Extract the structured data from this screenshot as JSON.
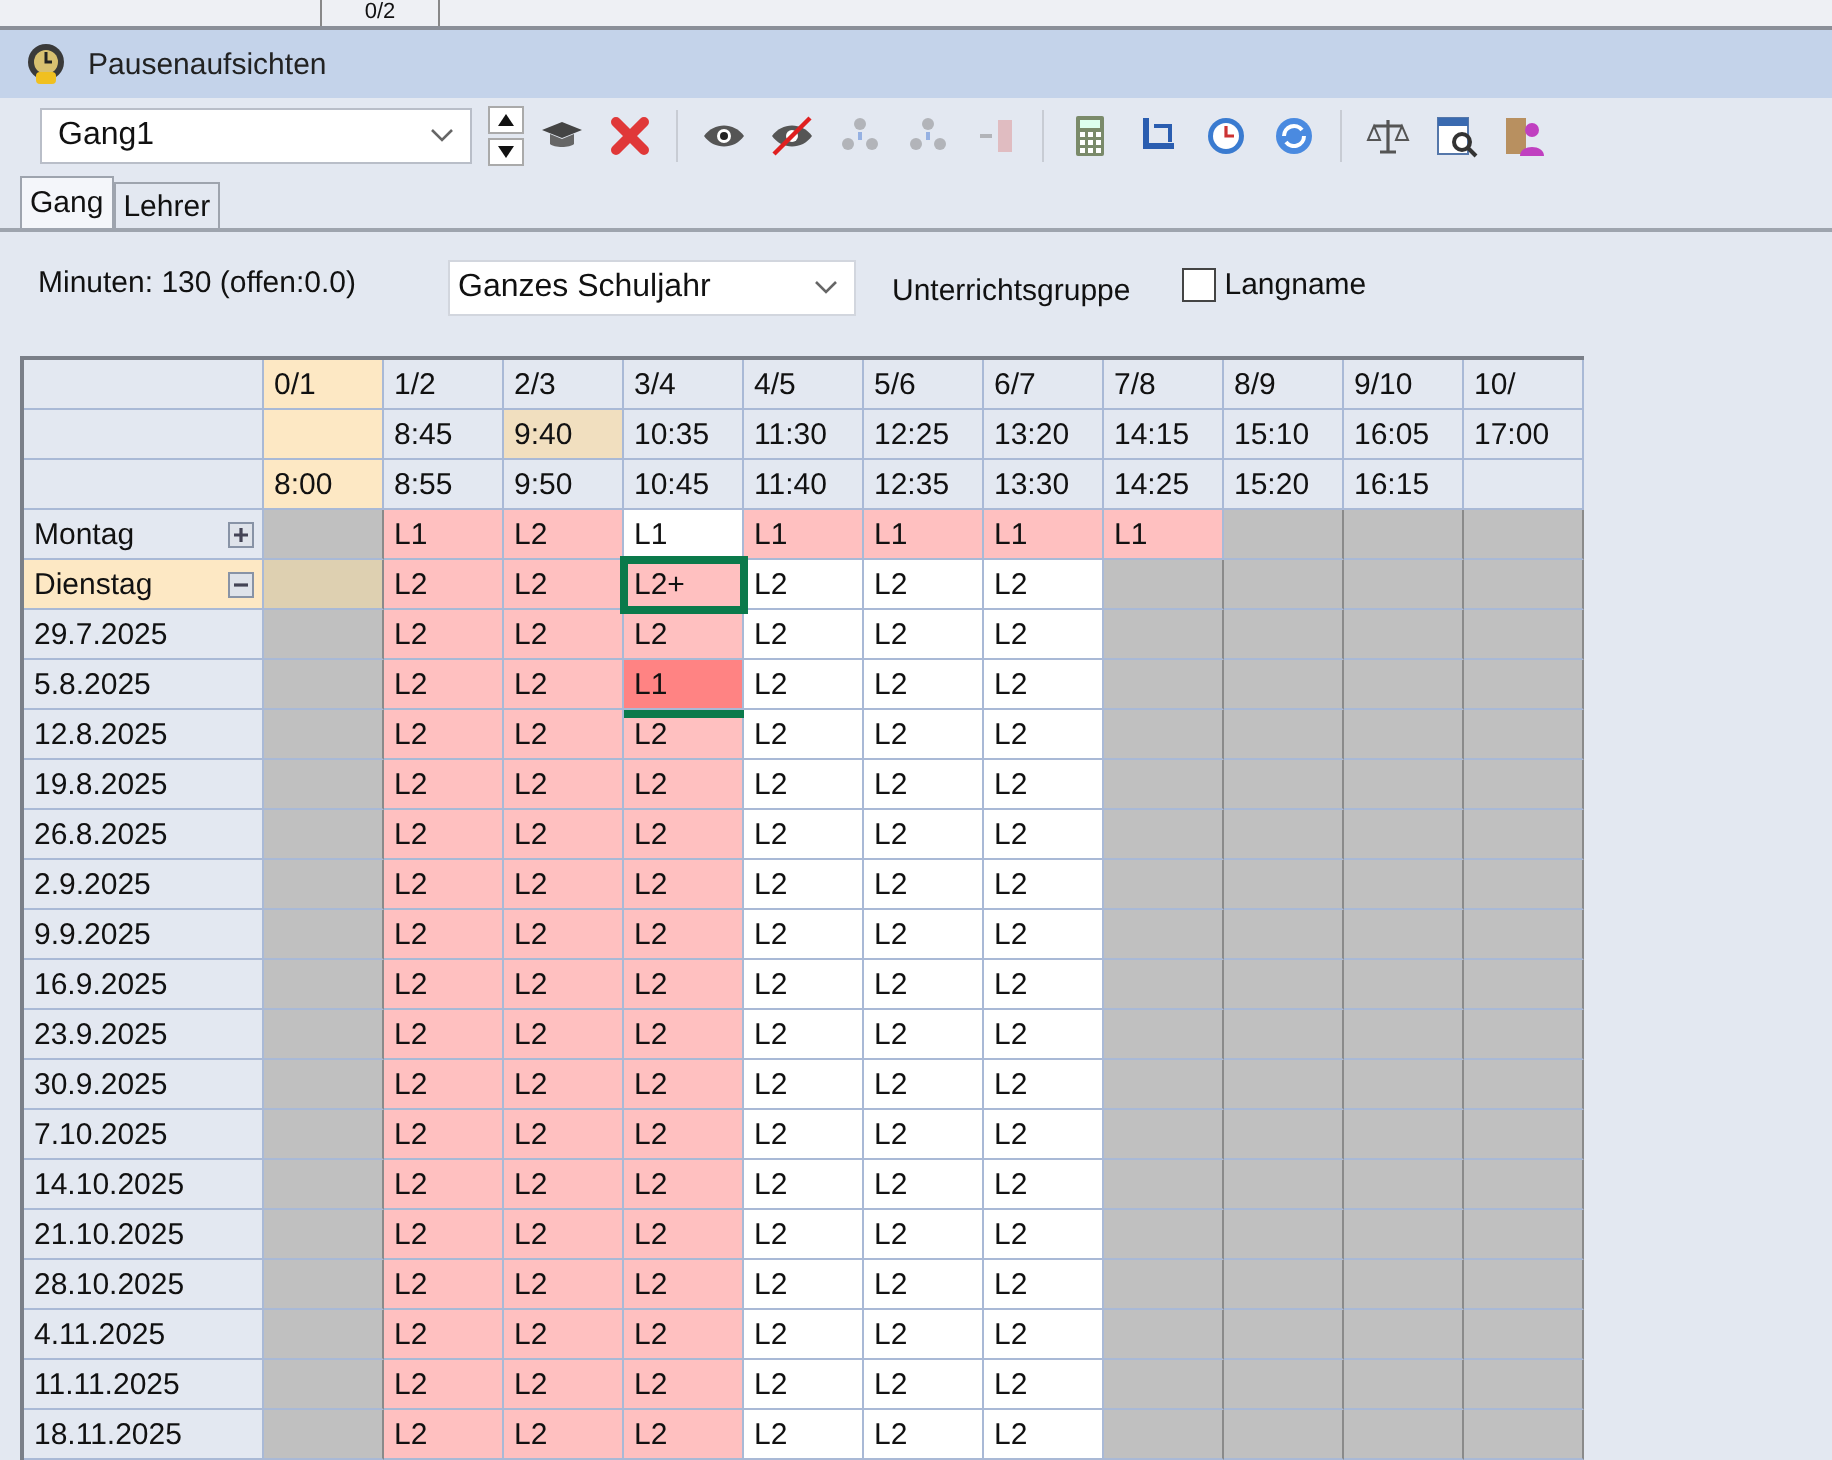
{
  "top_strip": {
    "cell": "0/2"
  },
  "window": {
    "title": "Pausenaufsichten"
  },
  "toolbar": {
    "selector": {
      "value": "Gang1"
    },
    "tools": [
      {
        "kind": "spinner",
        "disabled": false
      },
      {
        "kind": "cap",
        "disabled": false
      },
      {
        "kind": "delete",
        "disabled": false
      },
      {
        "kind": "sep"
      },
      {
        "kind": "eye",
        "disabled": false
      },
      {
        "kind": "eye-off",
        "disabled": false
      },
      {
        "kind": "people",
        "disabled": true
      },
      {
        "kind": "people",
        "disabled": true
      },
      {
        "kind": "stack",
        "disabled": true
      },
      {
        "kind": "sep"
      },
      {
        "kind": "calculator",
        "disabled": false
      },
      {
        "kind": "swap",
        "disabled": false
      },
      {
        "kind": "clock",
        "disabled": false
      },
      {
        "kind": "refresh",
        "disabled": false
      },
      {
        "kind": "sep"
      },
      {
        "kind": "scales",
        "disabled": false
      },
      {
        "kind": "report",
        "disabled": false
      },
      {
        "kind": "person",
        "disabled": false
      }
    ]
  },
  "tabs": [
    {
      "label": "Gang",
      "selected": true
    },
    {
      "label": "Lehrer",
      "selected": false
    }
  ],
  "info": {
    "minutes": "Minuten: 130 (offen:0.0)",
    "period": "Ganzes Schuljahr",
    "group_label": "Unterrichtsgruppe",
    "longname": {
      "label": "Langname",
      "checked": false
    }
  },
  "columns": [
    {
      "label": "0/1",
      "highlighted": true,
      "to": "8:00"
    },
    {
      "label": "1/2",
      "highlighted": false,
      "from": "8:45",
      "to": "8:55"
    },
    {
      "label": "2/3",
      "highlighted": false,
      "from": "9:40",
      "from_highlighted": true,
      "to": "9:50"
    },
    {
      "label": "3/4",
      "highlighted": false,
      "from": "10:35",
      "to": "10:45"
    },
    {
      "label": "4/5",
      "highlighted": false,
      "from": "11:30",
      "to": "11:40"
    },
    {
      "label": "5/6",
      "highlighted": false,
      "from": "12:25",
      "to": "12:35"
    },
    {
      "label": "6/7",
      "highlighted": false,
      "from": "13:20",
      "to": "13:30"
    },
    {
      "label": "7/8",
      "highlighted": false,
      "from": "14:15",
      "to": "14:25"
    },
    {
      "label": "8/9",
      "highlighted": false,
      "from": "15:10",
      "to": "15:20"
    },
    {
      "label": "9/10",
      "highlighted": false,
      "from": "16:05",
      "to": "16:15"
    },
    {
      "label": "10/",
      "highlighted": false,
      "from": "17:00"
    }
  ],
  "rows": [
    {
      "label": "Montag",
      "kind": "day",
      "expanded": false,
      "selected": false,
      "cells": [
        {
          "kind": "blocked"
        },
        {
          "text": "L1",
          "kind": "assigned"
        },
        {
          "text": "L2",
          "kind": "assigned"
        },
        {
          "text": "L1",
          "kind": "plain"
        },
        {
          "text": "L1",
          "kind": "assigned"
        },
        {
          "text": "L1",
          "kind": "assigned"
        },
        {
          "text": "L1",
          "kind": "assigned"
        },
        {
          "text": "L1",
          "kind": "assigned"
        },
        {
          "kind": "blocked"
        },
        {
          "kind": "blocked"
        },
        {
          "kind": "blocked"
        }
      ]
    },
    {
      "label": "Dienstag",
      "kind": "day",
      "expanded": true,
      "selected": true,
      "cells": [
        {
          "kind": "current"
        },
        {
          "text": "L2",
          "kind": "assigned"
        },
        {
          "text": "L2",
          "kind": "assigned"
        },
        {
          "text": "L2+",
          "kind": "assigned",
          "boxed": true
        },
        {
          "text": "L2",
          "kind": "plain"
        },
        {
          "text": "L2",
          "kind": "plain"
        },
        {
          "text": "L2",
          "kind": "plain"
        },
        {
          "kind": "blocked"
        },
        {
          "kind": "blocked"
        },
        {
          "kind": "blocked"
        },
        {
          "kind": "blocked"
        }
      ]
    },
    {
      "label": "29.7.2025",
      "kind": "date",
      "cells": [
        {
          "kind": "blocked"
        },
        {
          "text": "L2",
          "kind": "assigned"
        },
        {
          "text": "L2",
          "kind": "assigned"
        },
        {
          "text": "L2",
          "kind": "assigned"
        },
        {
          "text": "L2",
          "kind": "plain"
        },
        {
          "text": "L2",
          "kind": "plain"
        },
        {
          "text": "L2",
          "kind": "plain"
        },
        {
          "kind": "blocked"
        },
        {
          "kind": "blocked"
        },
        {
          "kind": "blocked"
        },
        {
          "kind": "blocked"
        }
      ]
    },
    {
      "label": "5.8.2025",
      "kind": "date",
      "cells": [
        {
          "kind": "blocked"
        },
        {
          "text": "L2",
          "kind": "assigned"
        },
        {
          "text": "L2",
          "kind": "assigned"
        },
        {
          "text": "L1",
          "kind": "conflict",
          "underlined": true
        },
        {
          "text": "L2",
          "kind": "plain"
        },
        {
          "text": "L2",
          "kind": "plain"
        },
        {
          "text": "L2",
          "kind": "plain"
        },
        {
          "kind": "blocked"
        },
        {
          "kind": "blocked"
        },
        {
          "kind": "blocked"
        },
        {
          "kind": "blocked"
        }
      ]
    },
    {
      "label": "12.8.2025",
      "kind": "date",
      "cells": [
        {
          "kind": "blocked"
        },
        {
          "text": "L2",
          "kind": "assigned"
        },
        {
          "text": "L2",
          "kind": "assigned"
        },
        {
          "text": "L2",
          "kind": "assigned"
        },
        {
          "text": "L2",
          "kind": "plain"
        },
        {
          "text": "L2",
          "kind": "plain"
        },
        {
          "text": "L2",
          "kind": "plain"
        },
        {
          "kind": "blocked"
        },
        {
          "kind": "blocked"
        },
        {
          "kind": "blocked"
        },
        {
          "kind": "blocked"
        }
      ]
    },
    {
      "label": "19.8.2025",
      "kind": "date",
      "cells": [
        {
          "kind": "blocked"
        },
        {
          "text": "L2",
          "kind": "assigned"
        },
        {
          "text": "L2",
          "kind": "assigned"
        },
        {
          "text": "L2",
          "kind": "assigned"
        },
        {
          "text": "L2",
          "kind": "plain"
        },
        {
          "text": "L2",
          "kind": "plain"
        },
        {
          "text": "L2",
          "kind": "plain"
        },
        {
          "kind": "blocked"
        },
        {
          "kind": "blocked"
        },
        {
          "kind": "blocked"
        },
        {
          "kind": "blocked"
        }
      ]
    },
    {
      "label": "26.8.2025",
      "kind": "date",
      "cells": [
        {
          "kind": "blocked"
        },
        {
          "text": "L2",
          "kind": "assigned"
        },
        {
          "text": "L2",
          "kind": "assigned"
        },
        {
          "text": "L2",
          "kind": "assigned"
        },
        {
          "text": "L2",
          "kind": "plain"
        },
        {
          "text": "L2",
          "kind": "plain"
        },
        {
          "text": "L2",
          "kind": "plain"
        },
        {
          "kind": "blocked"
        },
        {
          "kind": "blocked"
        },
        {
          "kind": "blocked"
        },
        {
          "kind": "blocked"
        }
      ]
    },
    {
      "label": "2.9.2025",
      "kind": "date",
      "cells": [
        {
          "kind": "blocked"
        },
        {
          "text": "L2",
          "kind": "assigned"
        },
        {
          "text": "L2",
          "kind": "assigned"
        },
        {
          "text": "L2",
          "kind": "assigned"
        },
        {
          "text": "L2",
          "kind": "plain"
        },
        {
          "text": "L2",
          "kind": "plain"
        },
        {
          "text": "L2",
          "kind": "plain"
        },
        {
          "kind": "blocked"
        },
        {
          "kind": "blocked"
        },
        {
          "kind": "blocked"
        },
        {
          "kind": "blocked"
        }
      ]
    },
    {
      "label": "9.9.2025",
      "kind": "date",
      "cells": [
        {
          "kind": "blocked"
        },
        {
          "text": "L2",
          "kind": "assigned"
        },
        {
          "text": "L2",
          "kind": "assigned"
        },
        {
          "text": "L2",
          "kind": "assigned"
        },
        {
          "text": "L2",
          "kind": "plain"
        },
        {
          "text": "L2",
          "kind": "plain"
        },
        {
          "text": "L2",
          "kind": "plain"
        },
        {
          "kind": "blocked"
        },
        {
          "kind": "blocked"
        },
        {
          "kind": "blocked"
        },
        {
          "kind": "blocked"
        }
      ]
    },
    {
      "label": "16.9.2025",
      "kind": "date",
      "cells": [
        {
          "kind": "blocked"
        },
        {
          "text": "L2",
          "kind": "assigned"
        },
        {
          "text": "L2",
          "kind": "assigned"
        },
        {
          "text": "L2",
          "kind": "assigned"
        },
        {
          "text": "L2",
          "kind": "plain"
        },
        {
          "text": "L2",
          "kind": "plain"
        },
        {
          "text": "L2",
          "kind": "plain"
        },
        {
          "kind": "blocked"
        },
        {
          "kind": "blocked"
        },
        {
          "kind": "blocked"
        },
        {
          "kind": "blocked"
        }
      ]
    },
    {
      "label": "23.9.2025",
      "kind": "date",
      "cells": [
        {
          "kind": "blocked"
        },
        {
          "text": "L2",
          "kind": "assigned"
        },
        {
          "text": "L2",
          "kind": "assigned"
        },
        {
          "text": "L2",
          "kind": "assigned"
        },
        {
          "text": "L2",
          "kind": "plain"
        },
        {
          "text": "L2",
          "kind": "plain"
        },
        {
          "text": "L2",
          "kind": "plain"
        },
        {
          "kind": "blocked"
        },
        {
          "kind": "blocked"
        },
        {
          "kind": "blocked"
        },
        {
          "kind": "blocked"
        }
      ]
    },
    {
      "label": "30.9.2025",
      "kind": "date",
      "cells": [
        {
          "kind": "blocked"
        },
        {
          "text": "L2",
          "kind": "assigned"
        },
        {
          "text": "L2",
          "kind": "assigned"
        },
        {
          "text": "L2",
          "kind": "assigned"
        },
        {
          "text": "L2",
          "kind": "plain"
        },
        {
          "text": "L2",
          "kind": "plain"
        },
        {
          "text": "L2",
          "kind": "plain"
        },
        {
          "kind": "blocked"
        },
        {
          "kind": "blocked"
        },
        {
          "kind": "blocked"
        },
        {
          "kind": "blocked"
        }
      ]
    },
    {
      "label": "7.10.2025",
      "kind": "date",
      "cells": [
        {
          "kind": "blocked"
        },
        {
          "text": "L2",
          "kind": "assigned"
        },
        {
          "text": "L2",
          "kind": "assigned"
        },
        {
          "text": "L2",
          "kind": "assigned"
        },
        {
          "text": "L2",
          "kind": "plain"
        },
        {
          "text": "L2",
          "kind": "plain"
        },
        {
          "text": "L2",
          "kind": "plain"
        },
        {
          "kind": "blocked"
        },
        {
          "kind": "blocked"
        },
        {
          "kind": "blocked"
        },
        {
          "kind": "blocked"
        }
      ]
    },
    {
      "label": "14.10.2025",
      "kind": "date",
      "cells": [
        {
          "kind": "blocked"
        },
        {
          "text": "L2",
          "kind": "assigned"
        },
        {
          "text": "L2",
          "kind": "assigned"
        },
        {
          "text": "L2",
          "kind": "assigned"
        },
        {
          "text": "L2",
          "kind": "plain"
        },
        {
          "text": "L2",
          "kind": "plain"
        },
        {
          "text": "L2",
          "kind": "plain"
        },
        {
          "kind": "blocked"
        },
        {
          "kind": "blocked"
        },
        {
          "kind": "blocked"
        },
        {
          "kind": "blocked"
        }
      ]
    },
    {
      "label": "21.10.2025",
      "kind": "date",
      "cells": [
        {
          "kind": "blocked"
        },
        {
          "text": "L2",
          "kind": "assigned"
        },
        {
          "text": "L2",
          "kind": "assigned"
        },
        {
          "text": "L2",
          "kind": "assigned"
        },
        {
          "text": "L2",
          "kind": "plain"
        },
        {
          "text": "L2",
          "kind": "plain"
        },
        {
          "text": "L2",
          "kind": "plain"
        },
        {
          "kind": "blocked"
        },
        {
          "kind": "blocked"
        },
        {
          "kind": "blocked"
        },
        {
          "kind": "blocked"
        }
      ]
    },
    {
      "label": "28.10.2025",
      "kind": "date",
      "cells": [
        {
          "kind": "blocked"
        },
        {
          "text": "L2",
          "kind": "assigned"
        },
        {
          "text": "L2",
          "kind": "assigned"
        },
        {
          "text": "L2",
          "kind": "assigned"
        },
        {
          "text": "L2",
          "kind": "plain"
        },
        {
          "text": "L2",
          "kind": "plain"
        },
        {
          "text": "L2",
          "kind": "plain"
        },
        {
          "kind": "blocked"
        },
        {
          "kind": "blocked"
        },
        {
          "kind": "blocked"
        },
        {
          "kind": "blocked"
        }
      ]
    },
    {
      "label": "4.11.2025",
      "kind": "date",
      "cells": [
        {
          "kind": "blocked"
        },
        {
          "text": "L2",
          "kind": "assigned"
        },
        {
          "text": "L2",
          "kind": "assigned"
        },
        {
          "text": "L2",
          "kind": "assigned"
        },
        {
          "text": "L2",
          "kind": "plain"
        },
        {
          "text": "L2",
          "kind": "plain"
        },
        {
          "text": "L2",
          "kind": "plain"
        },
        {
          "kind": "blocked"
        },
        {
          "kind": "blocked"
        },
        {
          "kind": "blocked"
        },
        {
          "kind": "blocked"
        }
      ]
    },
    {
      "label": "11.11.2025",
      "kind": "date",
      "cells": [
        {
          "kind": "blocked"
        },
        {
          "text": "L2",
          "kind": "assigned"
        },
        {
          "text": "L2",
          "kind": "assigned"
        },
        {
          "text": "L2",
          "kind": "assigned"
        },
        {
          "text": "L2",
          "kind": "plain"
        },
        {
          "text": "L2",
          "kind": "plain"
        },
        {
          "text": "L2",
          "kind": "plain"
        },
        {
          "kind": "blocked"
        },
        {
          "kind": "blocked"
        },
        {
          "kind": "blocked"
        },
        {
          "kind": "blocked"
        }
      ]
    },
    {
      "label": "18.11.2025",
      "kind": "date",
      "cells": [
        {
          "kind": "blocked"
        },
        {
          "text": "L2",
          "kind": "assigned"
        },
        {
          "text": "L2",
          "kind": "assigned"
        },
        {
          "text": "L2",
          "kind": "assigned"
        },
        {
          "text": "L2",
          "kind": "plain"
        },
        {
          "text": "L2",
          "kind": "plain"
        },
        {
          "text": "L2",
          "kind": "plain"
        },
        {
          "kind": "blocked"
        },
        {
          "kind": "blocked"
        },
        {
          "kind": "blocked"
        },
        {
          "kind": "blocked"
        }
      ]
    }
  ]
}
